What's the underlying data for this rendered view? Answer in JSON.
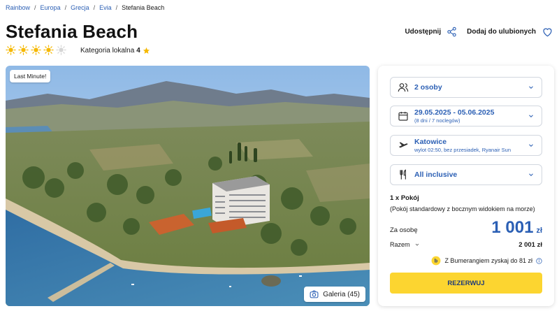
{
  "breadcrumb": [
    "Rainbow",
    "Europa",
    "Grecja",
    "Evia",
    "Stefania Beach"
  ],
  "breadcrumb_sep": "/",
  "hotel": {
    "name": "Stefania Beach",
    "suns_total": 5,
    "suns_filled": 4,
    "category_label": "Kategoria lokalna",
    "category_value": "4"
  },
  "actions": {
    "share_label": "Udostępnij",
    "favorite_label": "Dodaj do ulubionych"
  },
  "hero": {
    "badge": "Last Minute!",
    "gallery_label": "Galeria (45)"
  },
  "booking": {
    "guests": "2 osoby",
    "dates": "29.05.2025 - 05.06.2025",
    "dates_sub": "(8 dni / 7 noclegów)",
    "departure": "Katowice",
    "departure_sub": "wylot 02:50, bez przesiadek, Ryanair Sun",
    "board": "All inclusive",
    "room_count": "1 x Pokój",
    "room_type": "(Pokój standardowy z bocznym widokiem na morze)",
    "per_person_label": "Za osobę",
    "price": "1 001",
    "currency": "zł",
    "total_label": "Razem",
    "total_value": "2 001 zł",
    "bonus_text": "Z Bumerangiem zyskaj do 81 zł",
    "reserve_label": "REZERWUJ"
  },
  "colors": {
    "accent": "#2b5fb4",
    "button": "#fcd530",
    "sun": "#f5b800"
  },
  "icons": [
    "share-icon",
    "heart-icon",
    "sun-icon",
    "star-icon",
    "camera-icon",
    "user-icon",
    "calendar-icon",
    "plane-icon",
    "cutlery-icon",
    "chevron-down-icon",
    "info-icon",
    "boomerang-icon"
  ]
}
